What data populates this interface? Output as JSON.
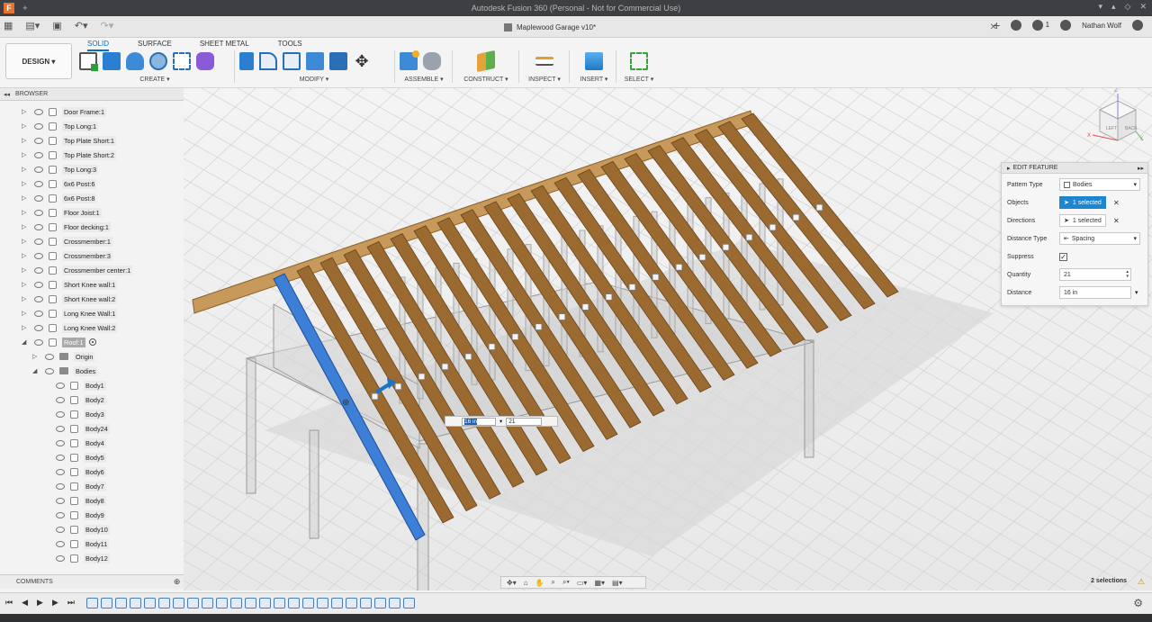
{
  "window": {
    "title": "Autodesk Fusion 360 (Personal - Not for Commercial Use)",
    "app_logo": "F",
    "controls": [
      "▾",
      "▴",
      "◇",
      "✕"
    ]
  },
  "doc": {
    "name": "Maplewood Garage v10*",
    "job_count": "1",
    "user": "Nathan Wolf"
  },
  "ribbon": {
    "workspace": "DESIGN ▾",
    "tabs": [
      "SOLID",
      "SURFACE",
      "SHEET METAL",
      "TOOLS"
    ],
    "groups": {
      "create": "CREATE ▾",
      "modify": "MODIFY ▾",
      "assemble": "ASSEMBLE ▾",
      "construct": "CONSTRUCT ▾",
      "inspect": "INSPECT ▾",
      "insert": "INSERT ▾",
      "select": "SELECT ▾"
    }
  },
  "browser": {
    "title": "BROWSER",
    "items": [
      {
        "label": "Door Frame:1"
      },
      {
        "label": "Top Long:1"
      },
      {
        "label": "Top Plate Short:1"
      },
      {
        "label": "Top Plate Short:2"
      },
      {
        "label": "Top Long:3"
      },
      {
        "label": "6x6 Post:6"
      },
      {
        "label": "6x6 Post:8"
      },
      {
        "label": "Floor Joist:1"
      },
      {
        "label": "Floor decking:1"
      },
      {
        "label": "Crossmember:1"
      },
      {
        "label": "Crossmember:3"
      },
      {
        "label": "Crossmember center:1"
      },
      {
        "label": "Short Knee wall:1"
      },
      {
        "label": "Short Knee wall:2"
      },
      {
        "label": "Long Knee Wall:1"
      },
      {
        "label": "Long Knee Wall:2"
      }
    ],
    "active_component": "Roof:1",
    "origin": "Origin",
    "bodies_folder": "Bodies",
    "bodies": [
      "Body1",
      "Body2",
      "Body3",
      "Body24",
      "Body4",
      "Body5",
      "Body6",
      "Body7",
      "Body8",
      "Body9",
      "Body10",
      "Body11",
      "Body12"
    ]
  },
  "comments": {
    "label": "COMMENTS"
  },
  "viewcube": {
    "face_top": "LEFT",
    "face_right": "BACK",
    "axis_x": "X",
    "axis_y": "Y",
    "axis_z": "Z"
  },
  "edit_feature": {
    "title": "EDIT FEATURE",
    "pattern_type_label": "Pattern Type",
    "pattern_type_value": "Bodies",
    "objects_label": "Objects",
    "objects_value": "1 selected",
    "directions_label": "Directions",
    "directions_value": "1 selected",
    "distance_type_label": "Distance Type",
    "distance_type_value": "Spacing",
    "suppress_label": "Suppress",
    "quantity_label": "Quantity",
    "quantity_value": "21",
    "distance_label": "Distance",
    "distance_value": "16 in"
  },
  "inline_input": {
    "distance": "16 in",
    "quantity": "21"
  },
  "status": {
    "selections": "2 selections"
  },
  "colors": {
    "accent": "#0a6fc2",
    "selection_blue": "#1c86d1",
    "wood": "#9a6a30",
    "wood_light": "#c79a5c",
    "titlebar": "#3d3f42"
  }
}
